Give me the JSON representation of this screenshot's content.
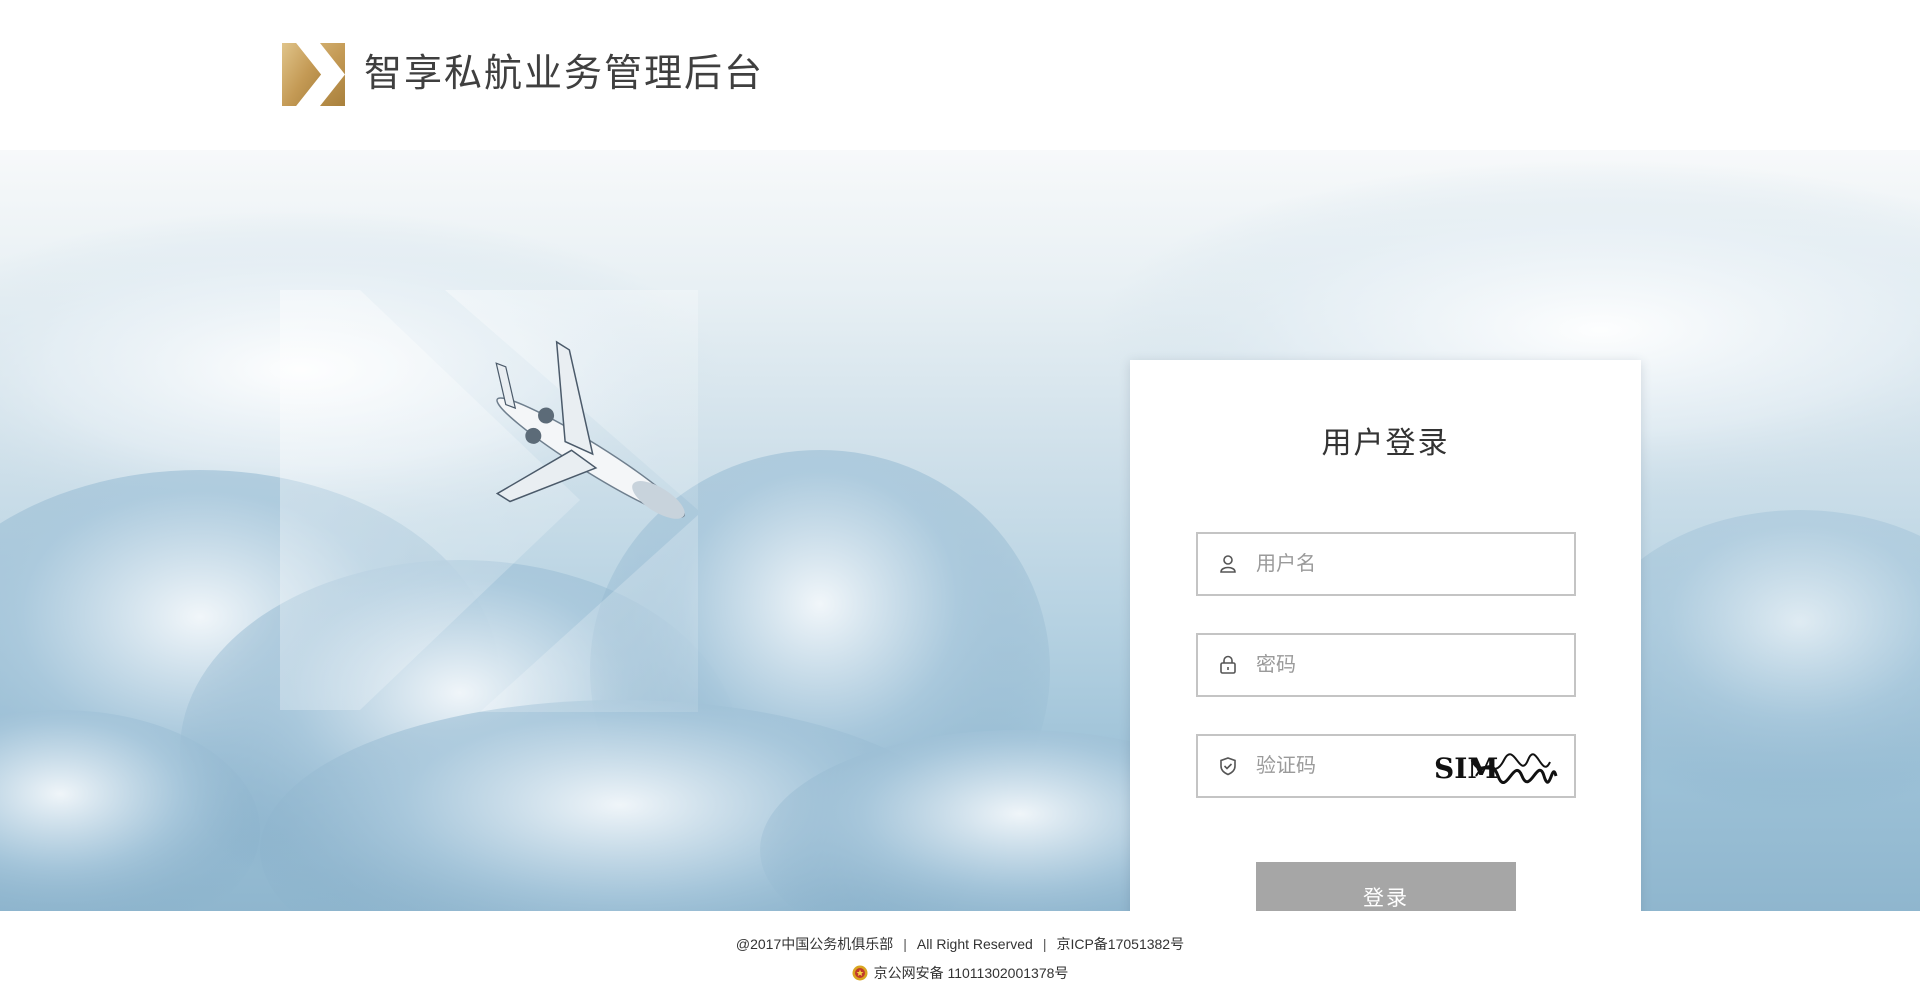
{
  "header": {
    "app_title": "智享私航业务管理后台",
    "logo": "gold-chevron-logo"
  },
  "hero": {
    "image": "private-jet-over-clouds"
  },
  "login": {
    "title": "用户登录",
    "username": {
      "placeholder": "用户名",
      "value": "",
      "icon": "user-icon"
    },
    "password": {
      "placeholder": "密码",
      "value": "",
      "icon": "lock-icon"
    },
    "captcha": {
      "placeholder": "验证码",
      "value": "",
      "icon": "shield-icon",
      "code": "SIM"
    },
    "submit_label": "登录",
    "submit_color": "#a6a6a6"
  },
  "footer": {
    "copyright": "@2017中国公务机俱乐部",
    "rights": "All Right Reserved",
    "icp": "京ICP备17051382号",
    "police_record": "京公网安备 11011302001378号",
    "police_icon": "police-badge-icon"
  },
  "colors": {
    "brand_gold": "#c9a363",
    "card_border": "#c4c4c4",
    "text": "#333333"
  }
}
